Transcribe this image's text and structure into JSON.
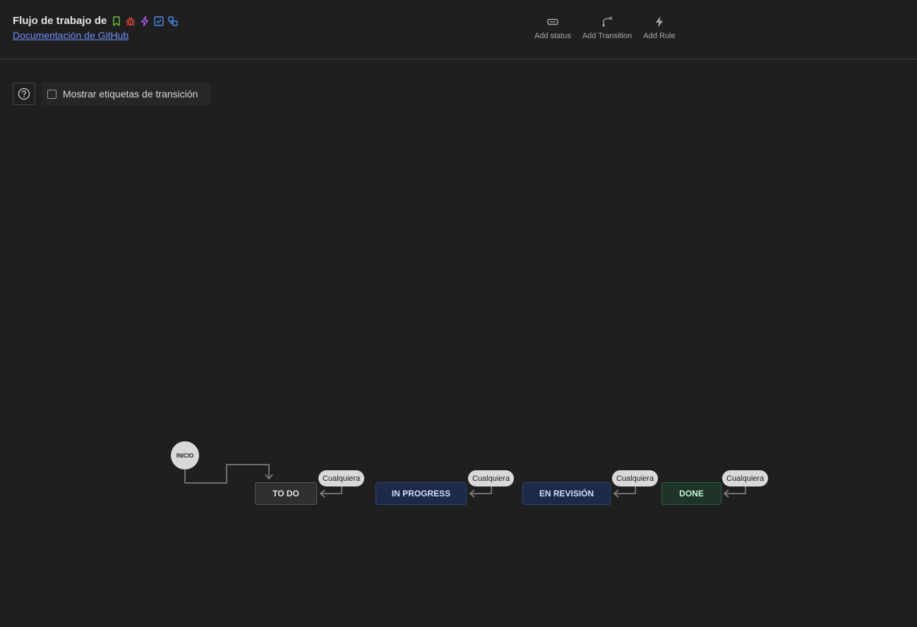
{
  "header": {
    "title": "Flujo de trabajo de",
    "doc_link": "Documentación de GitHub",
    "issue_type_icons": [
      "bookmark-icon",
      "bug-icon",
      "lightning-icon",
      "checkbox-icon",
      "subtask-icon"
    ],
    "icon_colors": {
      "bookmark": "#6aba3b",
      "bug": "#e5493a",
      "lightning": "#b15ae8",
      "checkbox": "#4b8af0",
      "subtask": "#4b8af0"
    }
  },
  "toolbar": {
    "add_status": "Add status",
    "add_transition": "Add Transition",
    "add_rule": "Add Rule"
  },
  "controls": {
    "show_transition_labels": "Mostrar etiquetas de transición",
    "show_transition_labels_checked": false
  },
  "workflow": {
    "start_label": "INICIO",
    "statuses": [
      {
        "name": "TO DO",
        "category_color": "#55575b"
      },
      {
        "name": "IN PROGRESS",
        "category_color": "#2b4375"
      },
      {
        "name": "EN REVISIÓN",
        "category_color": "#2b4375"
      },
      {
        "name": "DONE",
        "category_color": "#2f5a3e"
      }
    ],
    "any_label": "Cualquiera"
  }
}
